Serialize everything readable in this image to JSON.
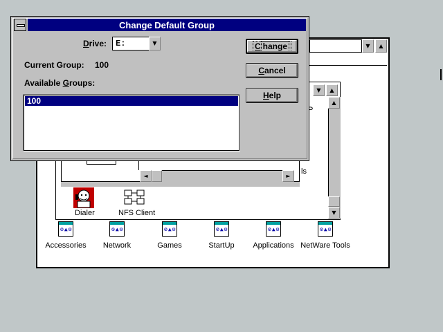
{
  "dialog": {
    "title": "Change Default Group",
    "drive_label_pre": "",
    "drive_label_u": "D",
    "drive_label_post": "rive:",
    "drive_value": "E:",
    "current_group_label": "Current Group:",
    "current_group_value": "100",
    "available_label_pre": "Available ",
    "available_label_u": "G",
    "available_label_post": "roups:",
    "groups": [
      "100"
    ],
    "change_button": {
      "u": "C",
      "rest": "hange"
    },
    "cancel_button": {
      "u": "C",
      "rest": "ancel"
    },
    "help_button": {
      "u": "H",
      "rest": "elp"
    }
  },
  "icons": {
    "arrow_down": "▼",
    "arrow_up": "▲",
    "arrow_left": "◄",
    "arrow_right": "►"
  },
  "inner_window": {
    "fragment_l": "ls",
    "fragment_p": "P"
  },
  "program_items": [
    {
      "label": "Dialer",
      "icon": "dialer-icon"
    },
    {
      "label": "NFS Client",
      "icon": "nfs-client-icon"
    }
  ],
  "groups_row": [
    {
      "label": "Accessories"
    },
    {
      "label": "Network"
    },
    {
      "label": "Games"
    },
    {
      "label": "StartUp"
    },
    {
      "label": "Applications"
    },
    {
      "label": "NetWare Tools"
    }
  ]
}
